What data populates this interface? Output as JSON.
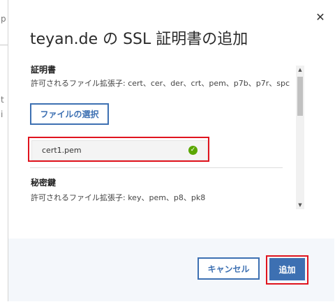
{
  "background": {
    "fragment_1": "p",
    "fragment_2": "t",
    "fragment_3": "i"
  },
  "dialog": {
    "title": "teyan.de の SSL 証明書の追加",
    "close_symbol": "✕"
  },
  "certificate": {
    "label": "証明書",
    "help": "許可されるファイル拡張子: cert、cer、der、crt、pem、p7b、p7r、spc",
    "select_button": "ファイルの選択",
    "file_name": "cert1.pem",
    "status_icon": "checkmark-circle-icon",
    "status_color": "#5aa700"
  },
  "private_key": {
    "label": "秘密鍵",
    "help": "許可されるファイル拡張子: key、pem、p8、pk8"
  },
  "scrollbar": {
    "up_arrow": "▲",
    "down_arrow": "▼"
  },
  "footer": {
    "cancel_label": "キャンセル",
    "add_label": "追加"
  },
  "colors": {
    "accent": "#3d70b2",
    "highlight": "#e0141e",
    "footer_bg": "#f4f7fb"
  }
}
